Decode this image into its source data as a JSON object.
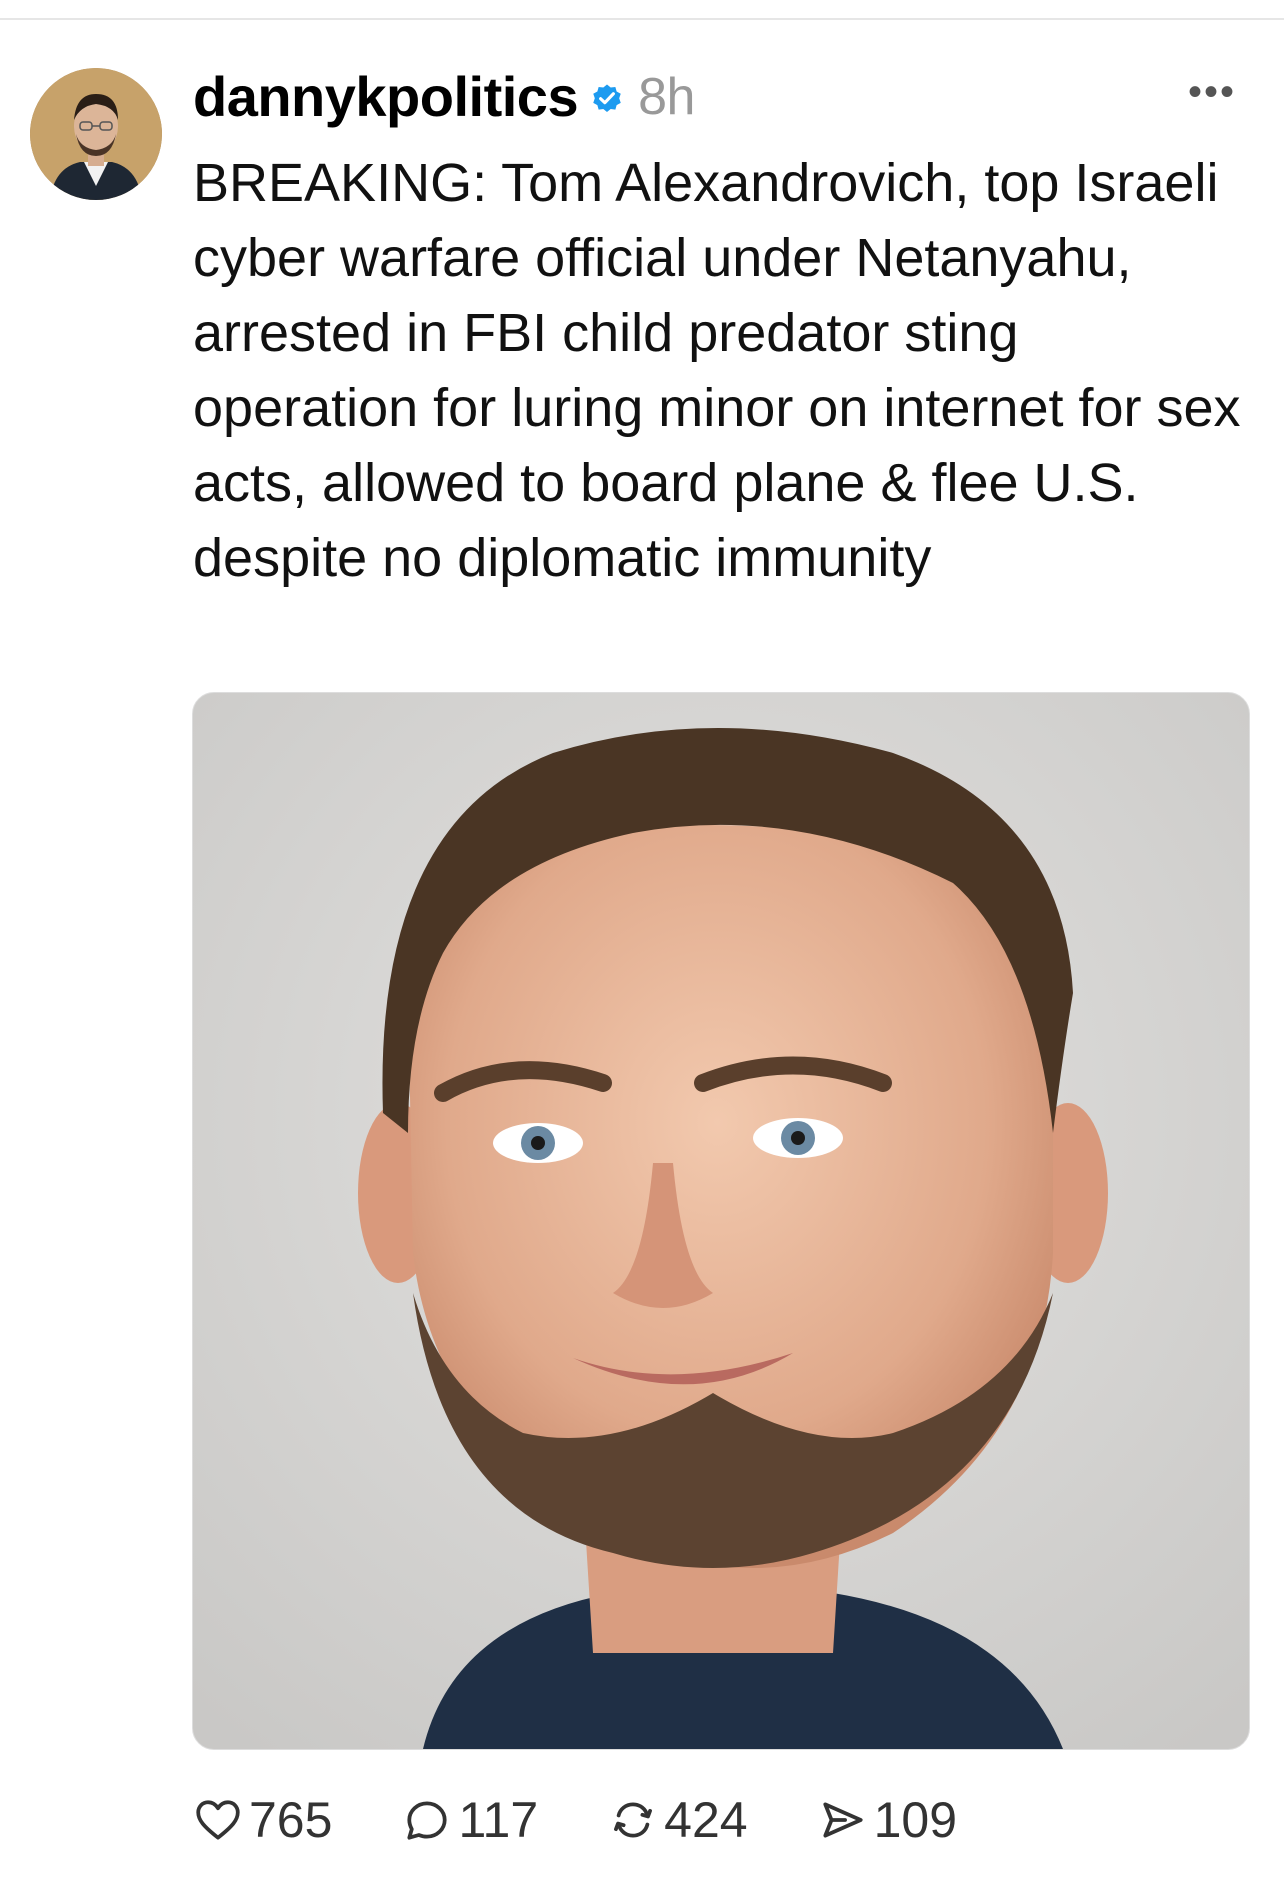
{
  "post": {
    "username": "dannykpolitics",
    "verified_icon": "verified-badge-icon",
    "time": "8h",
    "more_label": "•••",
    "text": "BREAKING: Tom Alexandrovich, top Israeli cyber warfare official under Netanyahu, arrested in FBI child predator sting operation for luring minor on internet for sex acts, allowed to board plane & flee U.S. despite no diplomatic immunity",
    "accent_color": "#1d9bf0"
  },
  "actions": {
    "likes": "765",
    "replies": "117",
    "reposts": "424",
    "shares": "109"
  }
}
